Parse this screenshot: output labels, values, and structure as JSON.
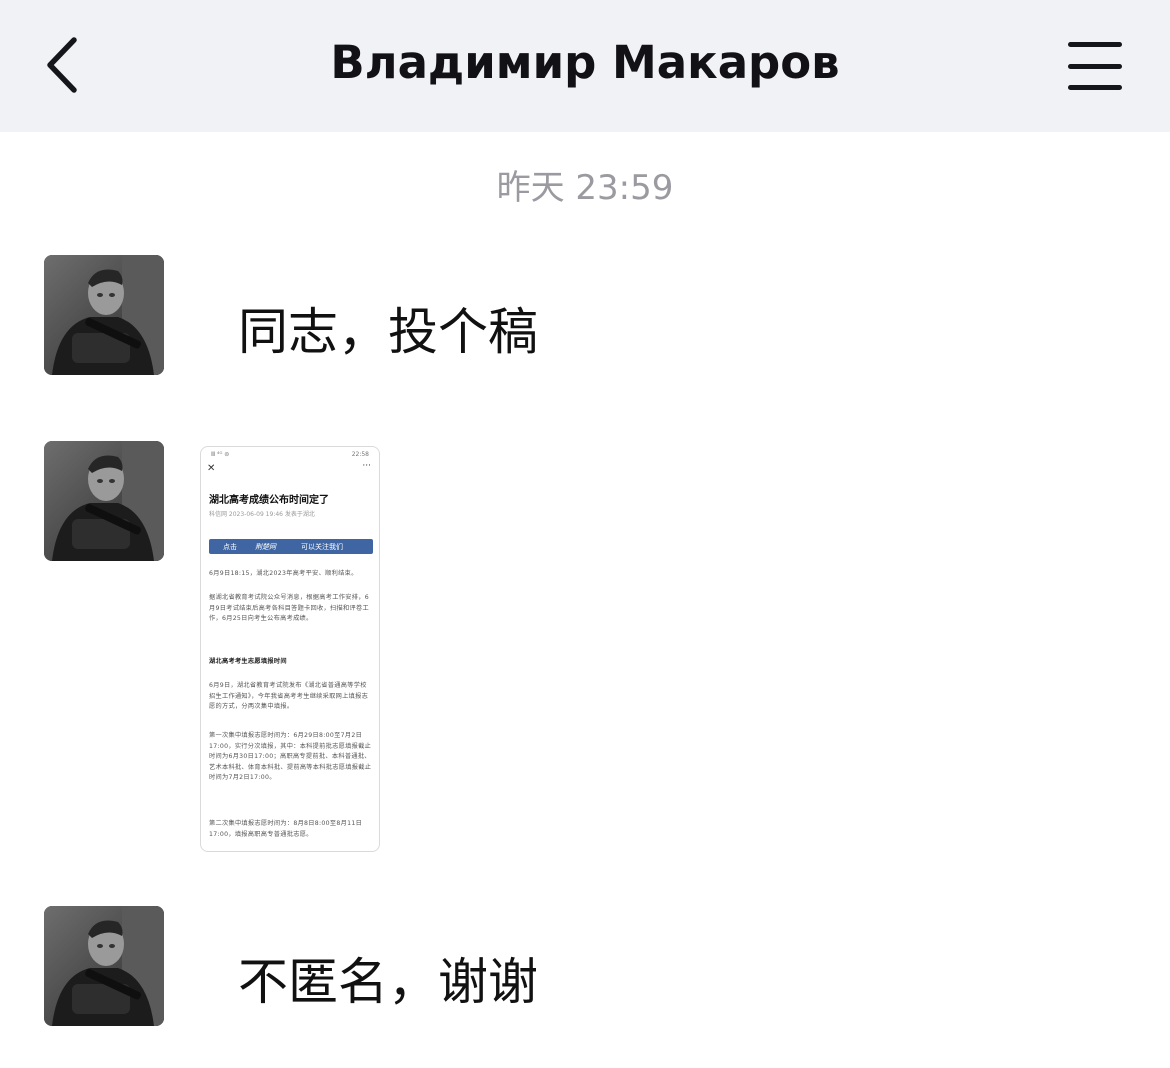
{
  "header": {
    "back_icon": "chevron-left-icon",
    "title": "Владимир Макаров",
    "menu_icon": "hamburger-menu-icon"
  },
  "chat": {
    "timestamp": "昨天 23:59",
    "messages": [
      {
        "type": "text",
        "text": "同志，投个稿"
      },
      {
        "type": "image",
        "article": {
          "status_left": "Ⅲ ⁴ᴳ ⊜",
          "status_right": "22:58",
          "close": "✕",
          "more": "···",
          "title": "湖北高考成绩公布时间定了",
          "meta": "科信网 2023-06-09 19:46 发表于湖北",
          "banner_tap": "点击",
          "banner_brand": "荆楚网",
          "banner_tail": "可以关注我们",
          "paragraphs": [
            {
              "text": "6月9日18:15，湖北2023年高考平安、顺利结束。",
              "bold": false
            },
            {
              "text": "据湖北省教育考试院公众号消息，根据高考工作安排，6月9日考试结束后高考各科目答题卡回收，扫描和评卷工作，6月25日向考生公布高考成绩。",
              "bold": false
            },
            {
              "text": "湖北高考考生志愿填报时间",
              "bold": true
            },
            {
              "text": "6月9日，湖北省教育考试院发布《湖北省普通高等学校招生工作通知》，今年我省高考考生继续采取网上填报志愿的方式，分两次集中填报。",
              "bold": false
            },
            {
              "text": "第一次集中填报志愿时间为：6月29日8:00至7月2日17:00，实行分次填报，其中：本科提前批志愿填报截止时间为6月30日17:00；高职高专提前批、本科普通批、艺术本科批、体育本科批、提前高等本科批志愿填报截止时间为7月2日17:00。",
              "bold": false
            },
            {
              "text": "第二次集中填报志愿时间为：8月8日8:00至8月11日17:00，填报高职高专普通批志愿。",
              "bold": false
            }
          ]
        }
      },
      {
        "type": "text",
        "text": "不匿名，谢谢"
      }
    ]
  }
}
